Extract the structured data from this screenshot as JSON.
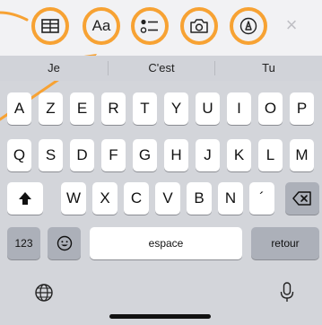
{
  "accent_color": "#f7a233",
  "toolbar": {
    "buttons": [
      {
        "name": "table-button",
        "icon": "table-icon"
      },
      {
        "name": "format-button",
        "icon": "text-format-icon",
        "label": "Aa"
      },
      {
        "name": "checklist-button",
        "icon": "checklist-icon"
      },
      {
        "name": "camera-button",
        "icon": "camera-icon"
      },
      {
        "name": "markup-button",
        "icon": "pen-tip-icon"
      }
    ],
    "close_icon": "close-icon",
    "close_glyph": "×"
  },
  "suggestions": [
    "Je",
    "C'est",
    "Tu"
  ],
  "keyboard": {
    "row1": [
      "A",
      "Z",
      "E",
      "R",
      "T",
      "Y",
      "U",
      "I",
      "O",
      "P"
    ],
    "row2": [
      "Q",
      "S",
      "D",
      "F",
      "G",
      "H",
      "J",
      "K",
      "L",
      "M"
    ],
    "row3": [
      "W",
      "X",
      "C",
      "V",
      "B",
      "N",
      "´"
    ],
    "numbers_label": "123",
    "space_label": "espace",
    "return_label": "retour",
    "shift_icon": "shift-icon",
    "delete_icon": "delete-icon",
    "emoji_icon": "emoji-icon",
    "globe_icon": "globe-icon",
    "mic_icon": "microphone-icon"
  }
}
